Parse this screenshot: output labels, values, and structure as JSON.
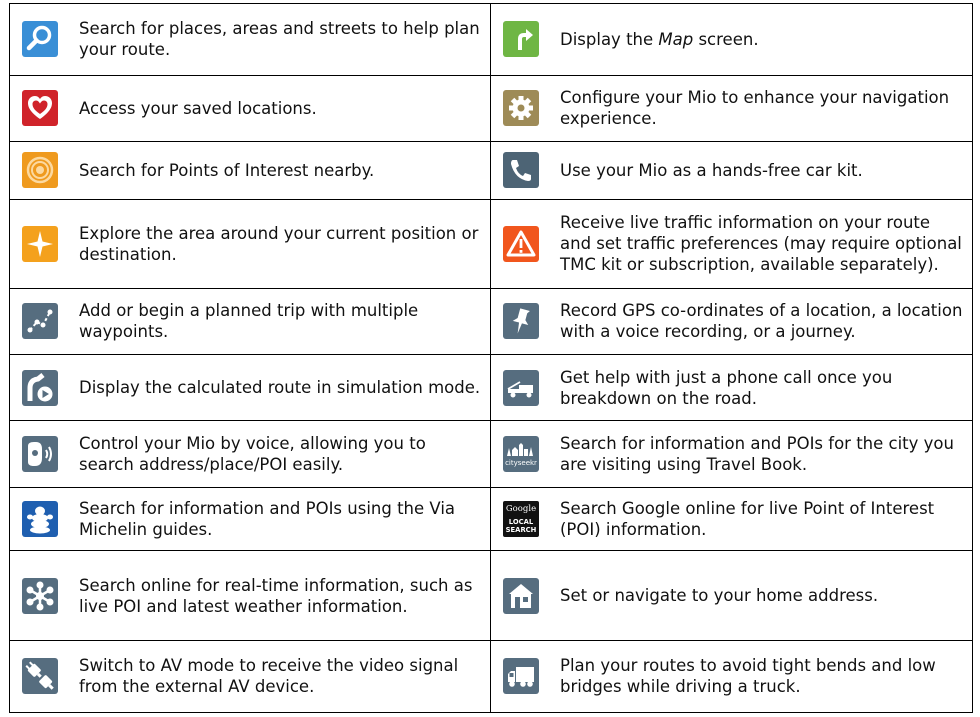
{
  "rows": [
    {
      "left": {
        "icon": "search-magnifier-icon",
        "color": "#3a8fd6",
        "text": "Search for places, areas and streets to help plan your route."
      },
      "right": {
        "icon": "map-arrow-icon",
        "color": "#6fb644",
        "text_before": "Display the ",
        "text_em": "Map",
        "text_after": " screen."
      }
    },
    {
      "left": {
        "icon": "heart-icon",
        "color": "#d0232a",
        "text": "Access your saved locations."
      },
      "right": {
        "icon": "gear-icon",
        "color": "#9e8b57",
        "text": "Configure your Mio to enhance your navigation experience."
      }
    },
    {
      "left": {
        "icon": "poi-target-icon",
        "color": "#ef9a1e",
        "text": "Search for Points of Interest nearby."
      },
      "right": {
        "icon": "phone-icon",
        "color": "#4d6475",
        "text": "Use your Mio as a hands-free car kit."
      }
    },
    {
      "left": {
        "icon": "explore-star-icon",
        "color": "#f4a11d",
        "text": "Explore the area around your current position or destination."
      },
      "right": {
        "icon": "traffic-warning-icon",
        "color": "#f1561d",
        "text": "Receive live traffic information on your route and set traffic preferences (may require optional TMC kit or subscription, available separately)."
      }
    },
    {
      "left": {
        "icon": "waypoints-icon",
        "color": "#566d7f",
        "text": "Add or begin a planned trip with multiple waypoints."
      },
      "right": {
        "icon": "pushpin-icon",
        "color": "#566d7f",
        "text": "Record GPS co-ordinates of a location, a location with a voice recording, or a journey."
      }
    },
    {
      "left": {
        "icon": "route-demo-icon",
        "color": "#566d7f",
        "text": "Display the calculated route in simulation mode."
      },
      "right": {
        "icon": "tow-truck-icon",
        "color": "#566d7f",
        "text": "Get help with just a phone call once you breakdown on the road."
      }
    },
    {
      "left": {
        "icon": "voice-control-icon",
        "color": "#566d7f",
        "text": "Control your Mio by voice, allowing you to search address/place/POI easily."
      },
      "right": {
        "icon": "cityseekr-icon",
        "color": "#566d7f",
        "icon_text": "cityseekr",
        "text": "Search for information and POIs for the city you are visiting using Travel Book."
      }
    },
    {
      "left": {
        "icon": "michelin-man-icon",
        "color": "#1f5fb0",
        "text": "Search for information and POIs using the Via Michelin guides."
      },
      "right": {
        "icon": "google-local-search-icon",
        "color": "#111111",
        "icon_text_1": "Google",
        "icon_text_2": "LOCAL",
        "icon_text_3": "SEARCH",
        "text": "Search Google online for live Point of Interest (POI) information."
      }
    },
    {
      "left": {
        "icon": "connected-services-icon",
        "color": "#566d7f",
        "text": "Search online for real-time information, such as live POI and latest weather information."
      },
      "right": {
        "icon": "home-icon",
        "color": "#566d7f",
        "text": "Set or navigate to your home address."
      }
    },
    {
      "left": {
        "icon": "av-plug-icon",
        "color": "#566d7f",
        "text": "Switch to AV mode to receive the video signal from the external AV device."
      },
      "right": {
        "icon": "truck-icon",
        "color": "#566d7f",
        "text": "Plan your routes to avoid tight bends and low bridges while driving a truck."
      }
    }
  ]
}
